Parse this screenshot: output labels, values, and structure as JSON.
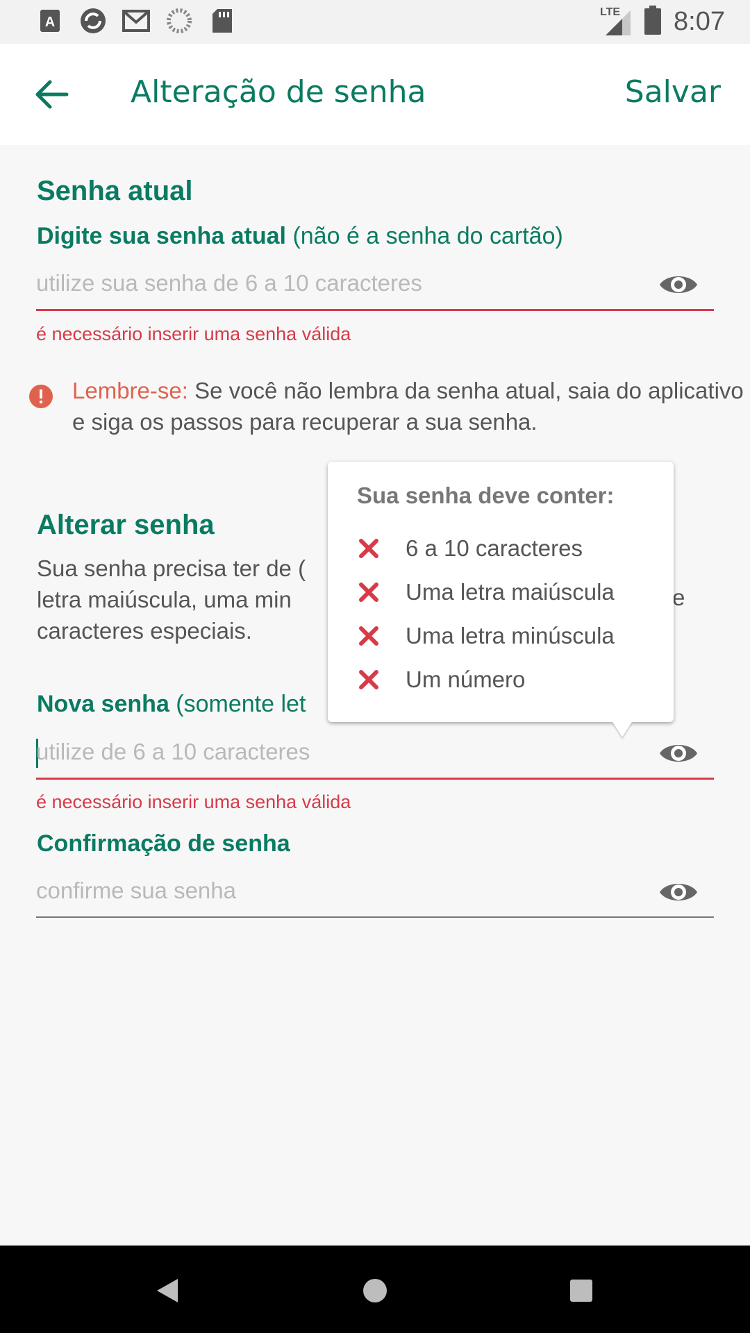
{
  "status_bar": {
    "time": "8:07",
    "network": "LTE",
    "left_icons": [
      "a-icon",
      "sync-icon",
      "gmail-icon",
      "loading-icon",
      "sd-card-icon"
    ]
  },
  "app_bar": {
    "title": "Alteração de senha",
    "save_label": "Salvar"
  },
  "current_password": {
    "section_title": "Senha atual",
    "label_bold": "Digite sua senha atual",
    "label_note": " (não é a senha do cartão)",
    "placeholder": "utilize sua senha de 6 a 10 caracteres",
    "error": "é necessário inserir uma senha válida"
  },
  "reminder": {
    "lead": "Lembre-se:",
    "text": " Se você não lembra da senha atual, saia do aplicativo e siga os passos para recuperar a sua senha."
  },
  "change_password": {
    "section_title": "Alterar senha",
    "description": "Sua senha precisa ter de 6 a 10 caracteres, com ao menos uma letra maiúscula, uma minúscula e um número. Não use espaços e caracteres especiais.",
    "visible_description_lines": [
      "Sua senha precisa ter de (",
      "letra maiúscula, uma min",
      "caracteres especiais."
    ],
    "trailing_char": "e",
    "new_label_bold": "Nova senha",
    "new_label_note": " (somente let",
    "new_placeholder": "utilize de 6 a 10 caracteres",
    "new_error": "é necessário inserir uma senha válida",
    "confirm_label": "Confirmação de senha",
    "confirm_placeholder": "confirme sua senha"
  },
  "requirements_popover": {
    "title": "Sua senha deve conter:",
    "items": [
      {
        "text": "6 a 10 caracteres",
        "met": false
      },
      {
        "text": "Uma letra maiúscula",
        "met": false
      },
      {
        "text": "Uma letra minúscula",
        "met": false
      },
      {
        "text": "Um número",
        "met": false
      }
    ]
  },
  "colors": {
    "brand_green": "#0a7b62",
    "error_red": "#d83a48",
    "reminder_orange": "#e0624e"
  }
}
